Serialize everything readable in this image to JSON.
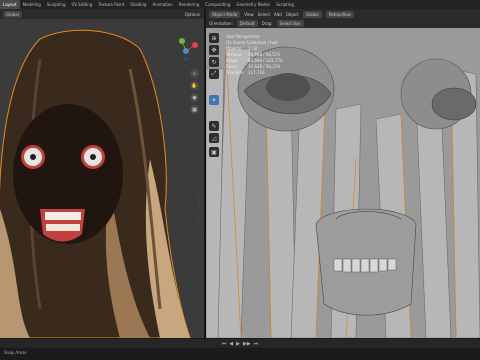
{
  "workspace_tabs": [
    "Layout",
    "Modeling",
    "Sculpting",
    "UV Editing",
    "Texture Paint",
    "Shading",
    "Animation",
    "Rendering",
    "Compositing",
    "Geometry Nodes",
    "Scripting"
  ],
  "left_viewport": {
    "header": {
      "transform": "Global",
      "options_label": "Options"
    }
  },
  "right_viewport": {
    "header": {
      "mode": "Object Mode",
      "menus": [
        "View",
        "Select",
        "Add",
        "Object"
      ],
      "transform": "Global",
      "shading": "Retopoflow"
    },
    "subheader": {
      "orientation_label": "Orientation:",
      "orientation_value": "Default",
      "drag_label": "Drag:",
      "drag_value": "Select Box"
    },
    "overlay_info": {
      "view_name": "User Perspective",
      "collection": "(1) Scene Collection | hair",
      "stats": [
        {
          "label": "Objects",
          "value": "1 / 8"
        },
        {
          "label": "Vertices",
          "value": "56,688 / 66,574"
        },
        {
          "label": "Edges",
          "value": "92,694 / 122,774"
        },
        {
          "label": "Faces",
          "value": "37,628 / 56,374"
        },
        {
          "label": "Triangles",
          "value": "117,716"
        }
      ]
    }
  },
  "status": {
    "text": "Snap Areas"
  },
  "tools": [
    "cursor-icon",
    "move-icon",
    "rotate-icon",
    "scale-icon",
    "transform-icon",
    "annotate-icon",
    "measure-icon",
    "add-cube-icon"
  ]
}
